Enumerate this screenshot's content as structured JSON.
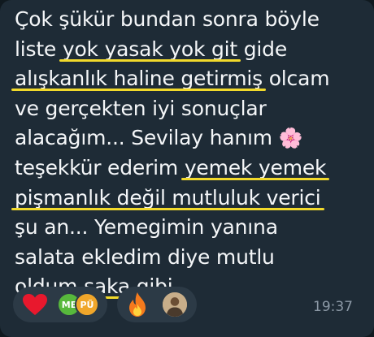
{
  "message": {
    "lines": [
      {
        "text": "Çok şükür bundan sonra böyle"
      },
      {
        "before": "liste ",
        "highlight": "yok yasak yok git",
        "after": " gide"
      },
      {
        "highlight": "alışkanlık haline getirmiş",
        "after": " olcam"
      },
      {
        "text": "ve gerçekten iyi sonuçlar"
      },
      {
        "text": "alacağım... Sevilay hanım "
      },
      {
        "before": "teşekkür ederim ",
        "highlight": "yemek yemek"
      },
      {
        "highlight": "pişmanlık değil mutluluk verici"
      },
      {
        "text": "şu an... Yemegimin yanına"
      },
      {
        "text": "salata ekledim diye mutlu"
      },
      {
        "before": "oldum ",
        "highlight": "şaka gibi"
      }
    ],
    "emoji_icon": "cherry-blossom-icon"
  },
  "reactions": [
    {
      "icon": "heart-icon",
      "avatars": [
        "ME",
        "PÜ"
      ]
    },
    {
      "icon": "fire-icon",
      "avatars": [
        "photo-avatar"
      ]
    }
  ],
  "timestamp": "19:37",
  "colors": {
    "bubble": "#1e2b36",
    "text": "#f4f6f8",
    "highlight_underline": "#f1d92b",
    "reaction_bg": "#2c3a46",
    "timestamp": "#8c99a6"
  }
}
